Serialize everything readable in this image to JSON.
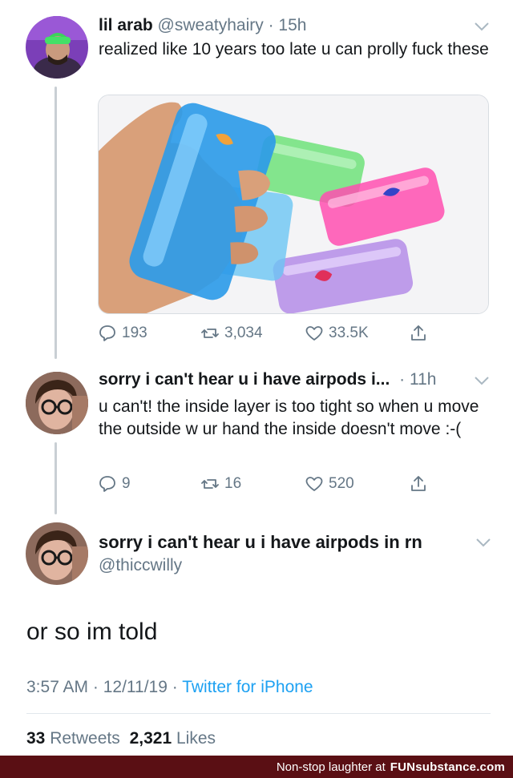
{
  "tweet1": {
    "name": "lil arab",
    "handle": "@sweatyhairy",
    "time": "· 15h",
    "text": "realized like 10 years too late u can prolly fuck these",
    "replies": "193",
    "retweets": "3,034",
    "likes": "33.5K"
  },
  "tweet2": {
    "name": "sorry i can't hear u i have airpods i...",
    "time": "· 11h",
    "text": "u can't! the inside layer is too tight so when u move the outside w ur hand the inside doesn't move :-(",
    "replies": "9",
    "retweets": "16",
    "likes": "520"
  },
  "main_tweet": {
    "name": "sorry i can't hear u i have airpods in rn",
    "handle": "@thiccwilly",
    "text": "or so im told",
    "timestamp": "3:57 AM · 12/11/19 ·",
    "source": "Twitter for iPhone",
    "retweet_count": "33",
    "retweet_label": "Retweets",
    "like_count": "2,321",
    "like_label": "Likes"
  },
  "footer": {
    "tagline": "Non-stop laughter at",
    "brand": "FUNsubstance.com"
  },
  "colors": {
    "text": "#14171a",
    "secondary": "#657786",
    "link": "#1da1f2",
    "footer_bg": "#5a0f14"
  }
}
